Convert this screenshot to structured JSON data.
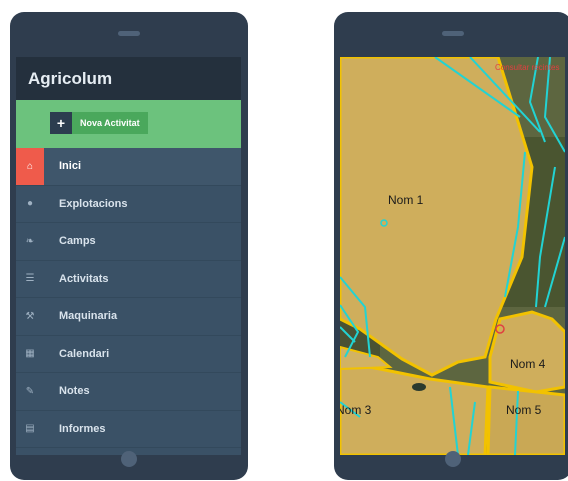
{
  "app": {
    "title": "Agricolum"
  },
  "actions": {
    "new_activity": "Nova Activitat",
    "plus": "+"
  },
  "menu": [
    {
      "label": "Inici",
      "icon": "home-icon",
      "glyph": "⌂",
      "active": true
    },
    {
      "label": "Explotacions",
      "icon": "globe-icon",
      "glyph": "●"
    },
    {
      "label": "Camps",
      "icon": "leaf-icon",
      "glyph": "❧"
    },
    {
      "label": "Activitats",
      "icon": "list-icon",
      "glyph": "☰"
    },
    {
      "label": "Maquinaria",
      "icon": "wrench-icon",
      "glyph": "⚒"
    },
    {
      "label": "Calendari",
      "icon": "calendar-icon",
      "glyph": "▦"
    },
    {
      "label": "Notes",
      "icon": "pencil-icon",
      "glyph": "✎"
    },
    {
      "label": "Informes",
      "icon": "book-icon",
      "glyph": "▤"
    }
  ],
  "map": {
    "fields": [
      {
        "label": "Nom 1"
      },
      {
        "label": "Nom 3"
      },
      {
        "label": "Nom 4"
      },
      {
        "label": "Nom 5"
      }
    ],
    "overlay_note": "Consultar recintes"
  },
  "colors": {
    "accent_green": "#6cc27d",
    "active_red": "#ef5b4b",
    "field_border": "#f2c200",
    "parcel_border": "#22d3d3",
    "field_fill": "#cfae5c"
  }
}
